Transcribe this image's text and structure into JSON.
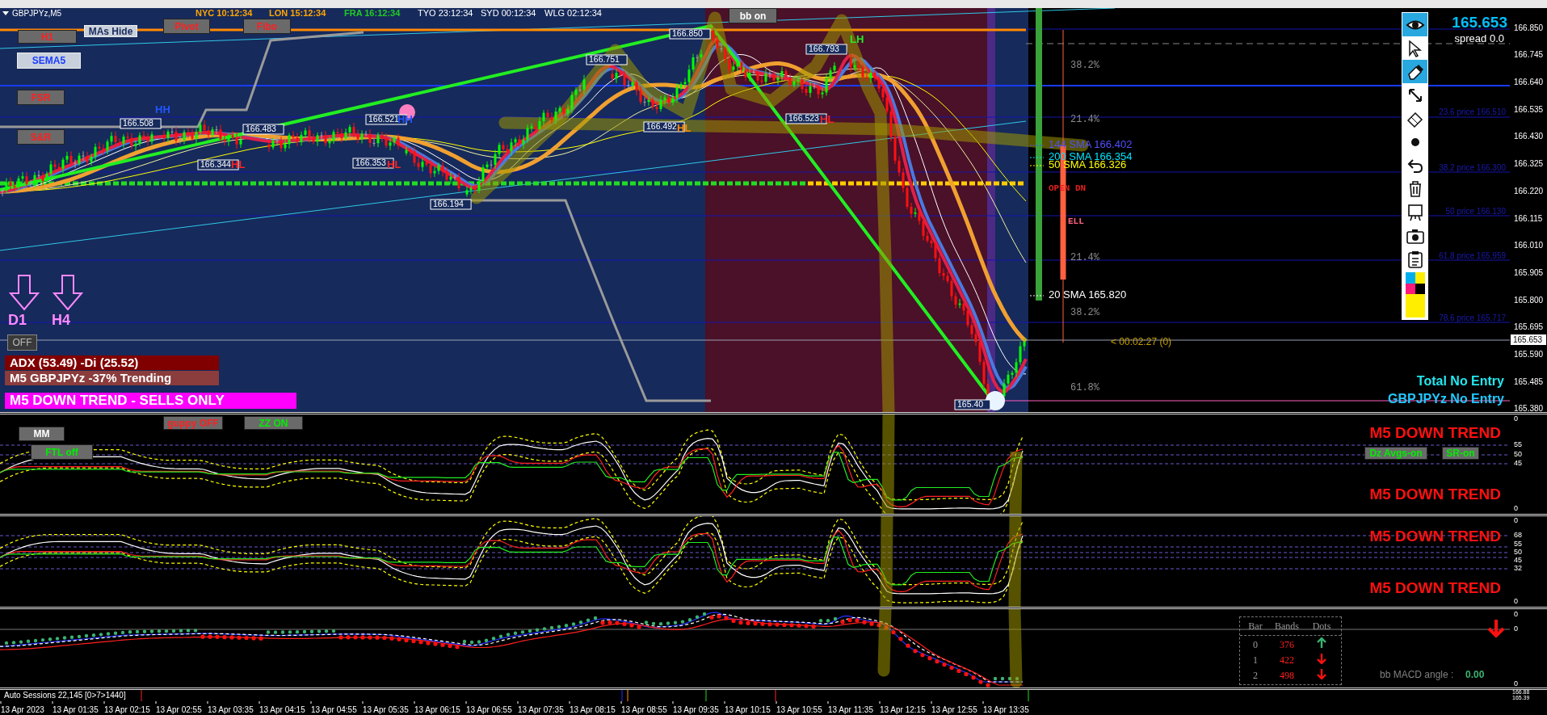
{
  "header": {
    "symbol": "GBPJPYz,M5",
    "clocks": [
      {
        "text": "NYC 10:12:34",
        "color": "#ffa500"
      },
      {
        "text": "LON 15:12:34",
        "color": "#ffa500"
      },
      {
        "text": "FRA 16:12:34",
        "color": "#22cc22"
      },
      {
        "text": "TYO 23:12:34",
        "color": "#ffffff"
      },
      {
        "text": "SYD 00:12:34",
        "color": "#ffffff"
      },
      {
        "text": "WLG 02:12:34",
        "color": "#ffffff"
      }
    ]
  },
  "chart_buttons": [
    {
      "label": "H1",
      "selected": false
    },
    {
      "label": "MAs Hide",
      "selected": true
    },
    {
      "label": "Pivot",
      "selected": false
    },
    {
      "label": "Fibo",
      "selected": false
    },
    {
      "label": "SEMA5",
      "selected": true
    },
    {
      "label": "FSR",
      "selected": false
    },
    {
      "label": "S&R",
      "selected": false
    },
    {
      "label": "bb on",
      "selected": false
    }
  ],
  "price_tags": [
    "166.508",
    "166.344",
    "166.483",
    "166.353",
    "166.521",
    "166.194",
    "166.751",
    "166.492",
    "166.850",
    "166.793",
    "166.523",
    "165.40"
  ],
  "swing_labels": [
    {
      "text": "HH",
      "color": "#2255ff"
    },
    {
      "text": "HL",
      "color": "#ff2020"
    },
    {
      "text": "HL",
      "color": "#ff2020"
    },
    {
      "text": "HH",
      "color": "#2255ff"
    },
    {
      "text": "HL",
      "color": "#ff8c00"
    },
    {
      "text": "LH",
      "color": "#22ee22"
    },
    {
      "text": "HL",
      "color": "#ff2020"
    }
  ],
  "ma_labels": [
    {
      "text": "144 SMA 166.402",
      "color": "#5050ff"
    },
    {
      "text": "200 SMA 166.354",
      "color": "#00e5ff"
    },
    {
      "text": "50 SMA 166.326",
      "color": "#ffff00"
    },
    {
      "text": "20 SMA 165.820",
      "color": "#ffffff"
    }
  ],
  "fib_percents": [
    "38.2%",
    "21.4%",
    "21.4%",
    "38.2%",
    "61.8%"
  ],
  "fib_prices": [
    "23.6 price 166.510",
    "38.2 price 166.300",
    "50 price 166.130",
    "61.8 price 165.959",
    "78.6 price 165.717"
  ],
  "signals": {
    "open": "OPEN DN",
    "sell": "ELL",
    "timer": "< 00:02:27 (0)"
  },
  "quote": {
    "bid": "165.653",
    "spread": "spread 0.0"
  },
  "entry_status": [
    "Total No Entry",
    "GBPJPYz No Entry"
  ],
  "tools": [
    {
      "kind": "eye",
      "selected": true
    },
    {
      "kind": "cursor",
      "selected": false
    },
    {
      "kind": "eraser",
      "selected": true
    },
    {
      "kind": "arrow",
      "selected": false
    },
    {
      "kind": "rubber",
      "selected": false
    },
    {
      "kind": "dot",
      "selected": false
    },
    {
      "kind": "undo",
      "selected": false
    },
    {
      "kind": "trash",
      "selected": false
    },
    {
      "kind": "easel",
      "selected": false
    },
    {
      "kind": "camera",
      "selected": false
    },
    {
      "kind": "clipboard",
      "selected": false
    },
    {
      "kind": "palette",
      "selected": false
    }
  ],
  "price_axis": [
    "166.850",
    "166.745",
    "166.640",
    "166.535",
    "166.430",
    "166.325",
    "166.220",
    "166.115",
    "166.010",
    "165.905",
    "165.800",
    "165.695",
    "165.590",
    "165.485",
    "165.380"
  ],
  "current_price": "165.653",
  "timeframe_arrows": [
    "D1",
    "H4"
  ],
  "off_button": "OFF",
  "info_panels": [
    {
      "text": "ADX (53.49)  -Di (25.52)",
      "color": "#800000"
    },
    {
      "text": "M5 GBPJPYz -37% Trending",
      "color": "#8b3c3c"
    },
    {
      "text": "M5  DOWN TREND - SELLS ONLY",
      "color": "#ff00ff"
    }
  ],
  "subwindow_1": {
    "buttons": [
      {
        "label": "MM"
      },
      {
        "label": "guppy OFF"
      },
      {
        "label": "ZZ ON"
      },
      {
        "label": "FTL off"
      },
      {
        "label": "Dz Avgs-on"
      },
      {
        "label": "SR-on"
      }
    ],
    "trend_labels": [
      "M5 DOWN TREND",
      "M5 DOWN TREND"
    ],
    "scale": [
      "0",
      "55",
      "50",
      "45",
      "0"
    ]
  },
  "subwindow_2": {
    "trend_labels": [
      "M5 DOWN TREND",
      "M5 DOWN TREND"
    ],
    "scale": [
      "0",
      "68",
      "55",
      "50",
      "45",
      "32",
      "0"
    ]
  },
  "subwindow_3": {
    "scale": [
      "0",
      "0",
      "0"
    ],
    "table": {
      "columns": [
        "Bar",
        "Bands",
        "Dots"
      ],
      "rows": [
        {
          "bar": "0",
          "bands": "376",
          "dots_up": true
        },
        {
          "bar": "1",
          "bands": "422",
          "dots_up": false
        },
        {
          "bar": "2",
          "bands": "498",
          "dots_up": false
        }
      ]
    },
    "signal_up": false,
    "macd": {
      "label": "bb MACD angle :",
      "value": "0.00"
    }
  },
  "sessions_bar": {
    "label": "Auto Sessions 22,145 [0>7>1440]",
    "scale": [
      "166.88",
      "165.39"
    ]
  },
  "time_axis": [
    "13 Apr 2023",
    "13 Apr 01:35",
    "13 Apr 02:15",
    "13 Apr 02:55",
    "13 Apr 03:35",
    "13 Apr 04:15",
    "13 Apr 04:55",
    "13 Apr 05:35",
    "13 Apr 06:15",
    "13 Apr 06:55",
    "13 Apr 07:35",
    "13 Apr 08:15",
    "13 Apr 08:55",
    "13 Apr 09:35",
    "13 Apr 10:15",
    "13 Apr 10:55",
    "13 Apr 11:35",
    "13 Apr 12:15",
    "13 Apr 12:55",
    "13 Apr 13:35"
  ]
}
